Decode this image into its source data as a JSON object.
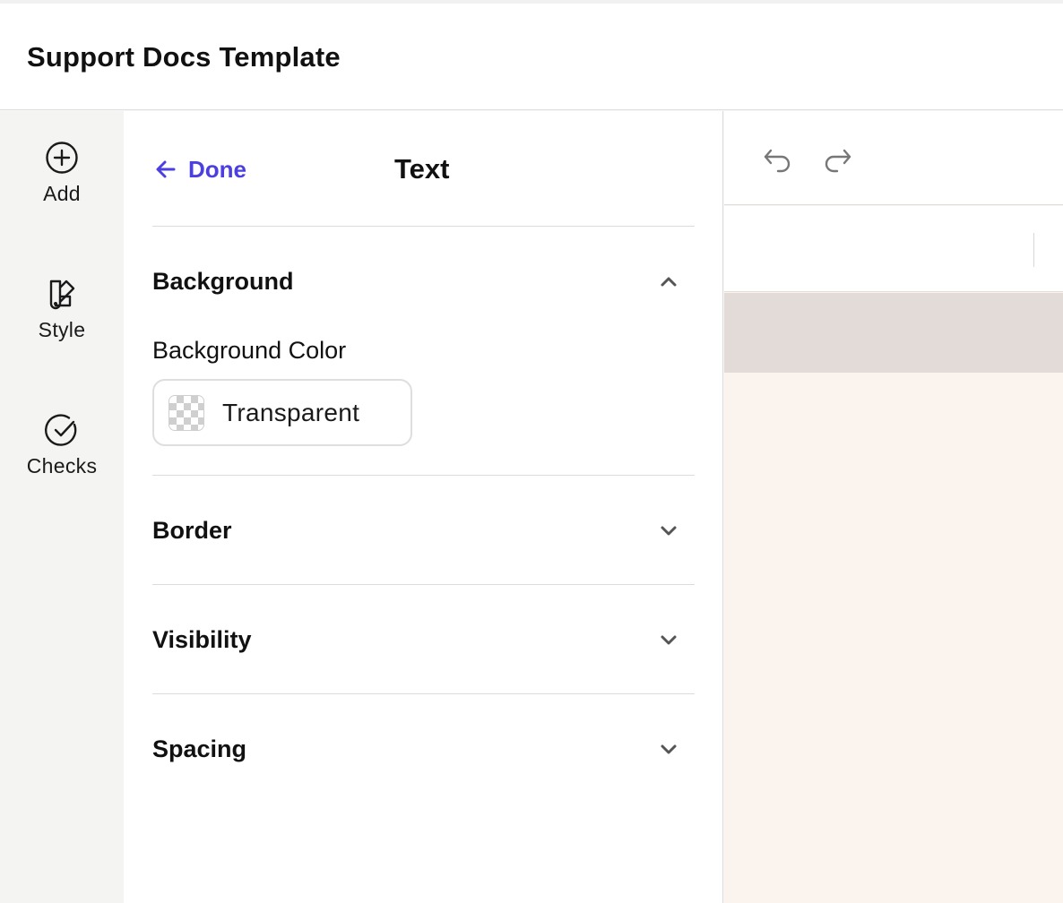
{
  "header": {
    "title": "Support Docs Template"
  },
  "rail": {
    "items": [
      {
        "label": "Add",
        "icon": "plus-circle-icon"
      },
      {
        "label": "Style",
        "icon": "swatch-book-icon"
      },
      {
        "label": "Checks",
        "icon": "check-circle-icon"
      }
    ]
  },
  "panel": {
    "back_label": "Done",
    "title": "Text",
    "sections": [
      {
        "title": "Background",
        "expanded": true
      },
      {
        "title": "Border",
        "expanded": false
      },
      {
        "title": "Visibility",
        "expanded": false
      },
      {
        "title": "Spacing",
        "expanded": false
      }
    ],
    "background_color": {
      "label": "Background Color",
      "value": "Transparent"
    }
  },
  "toolbar": {
    "undo_icon": "undo-icon",
    "redo_icon": "redo-icon"
  },
  "colors": {
    "accent": "#4b3fe0",
    "canvas": "#fbf3ee",
    "canvas_band": "#e3dbd7",
    "rail_bg": "#f4f4f3"
  }
}
